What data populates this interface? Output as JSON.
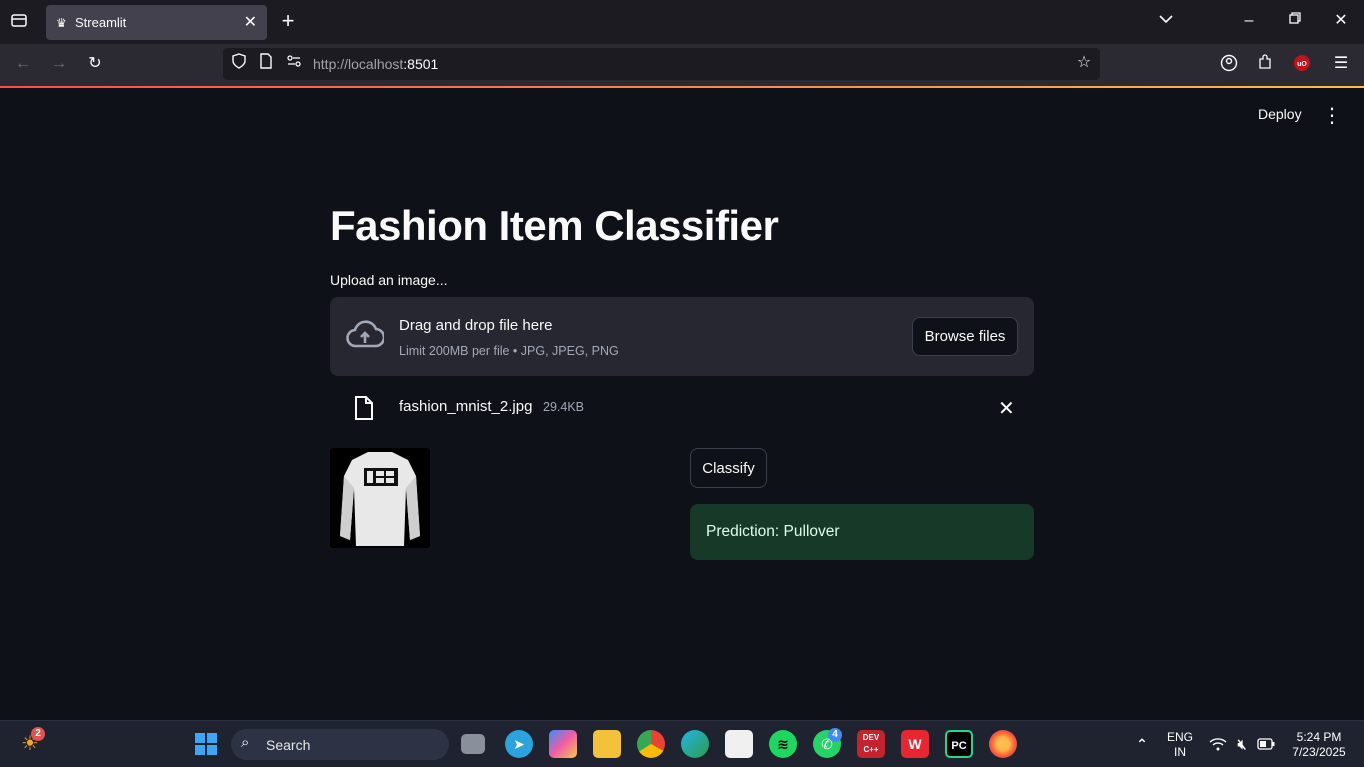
{
  "browser": {
    "tab_title": "Streamlit",
    "url_host": "http://localhost",
    "url_port": ":8501"
  },
  "app": {
    "deploy_label": "Deploy",
    "title": "Fashion Item Classifier",
    "upload_label": "Upload an image...",
    "dropzone_main": "Drag and drop file here",
    "dropzone_sub": "Limit 200MB per file • JPG, JPEG, PNG",
    "browse_label": "Browse files",
    "file_name": "fashion_mnist_2.jpg",
    "file_size": "29.4KB",
    "classify_label": "Classify",
    "prediction_text": "Prediction: Pullover"
  },
  "taskbar": {
    "search_label": "Search",
    "weather_badge": "2",
    "whatsapp_badge": "4",
    "lang_line1": "ENG",
    "lang_line2": "IN",
    "time": "5:24 PM",
    "date": "7/23/2025"
  },
  "colors": {
    "app_bg": "#0e1117",
    "prediction_bg": "#173928",
    "accent_red": "#ff4b4b"
  }
}
